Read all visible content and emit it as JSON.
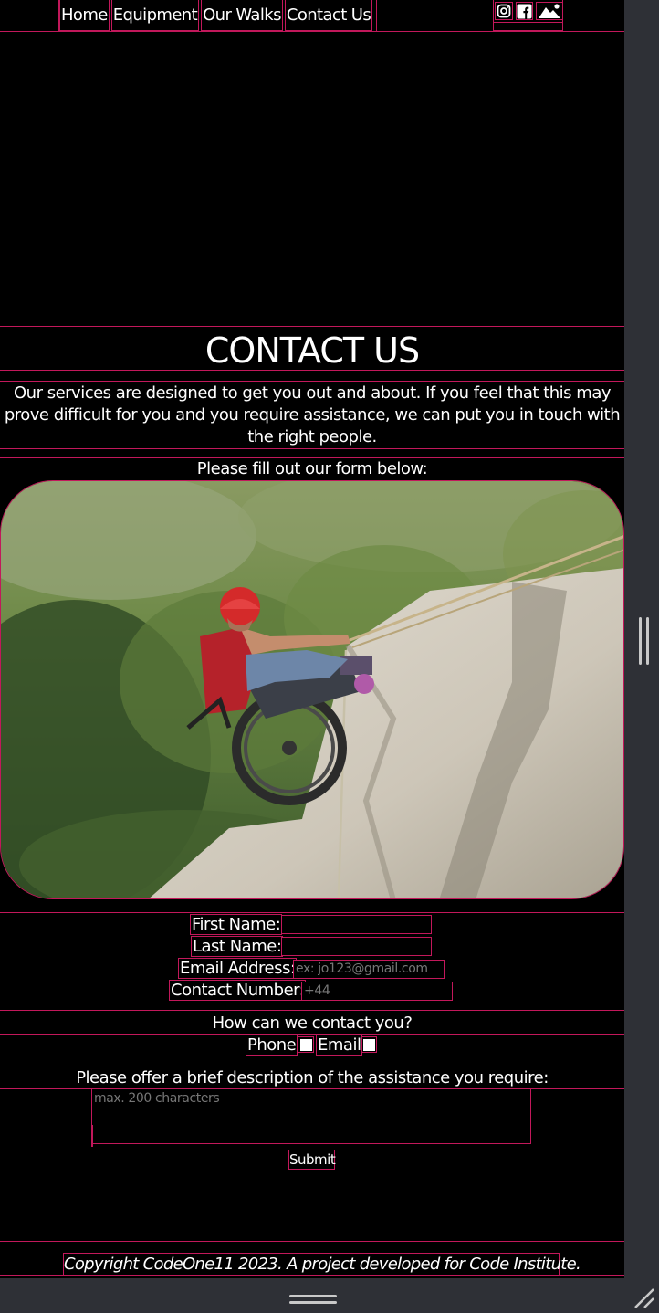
{
  "nav": {
    "links": [
      "Home",
      "Equipment",
      "Our Walks",
      "Contact Us"
    ],
    "social_icons": [
      "instagram-icon",
      "facebook-icon",
      "image-icon"
    ]
  },
  "main": {
    "title": "CONTACT US",
    "intro": "Our services are designed to get you out and about. If you feel that this may prove difficult for you and you require assistance, we can put you in touch with the right people.",
    "fill_prompt": "Please fill out our form below:",
    "image": "person-in-wheelchair-abseiling-down-rock"
  },
  "form": {
    "first_name_label": "First Name:",
    "last_name_label": "Last Name:",
    "email_label": "Email Address:",
    "email_placeholder": "ex: jo123@gmail.com",
    "phone_label": "Contact Number:",
    "phone_placeholder": "+44",
    "contact_question": "How can we contact you?",
    "contact_options": [
      "Phone",
      "Email"
    ],
    "description_label": "Please offer a brief description of the assistance you require:",
    "description_placeholder": "max. 200 characters",
    "submit_label": "Submit"
  },
  "footer": {
    "text": "Copyright CodeOne11 2023. A project developed for Code Institute."
  },
  "colors": {
    "background": "#000000",
    "outline": "#c2185b",
    "text": "#ffffff",
    "chrome": "#2e3036"
  }
}
